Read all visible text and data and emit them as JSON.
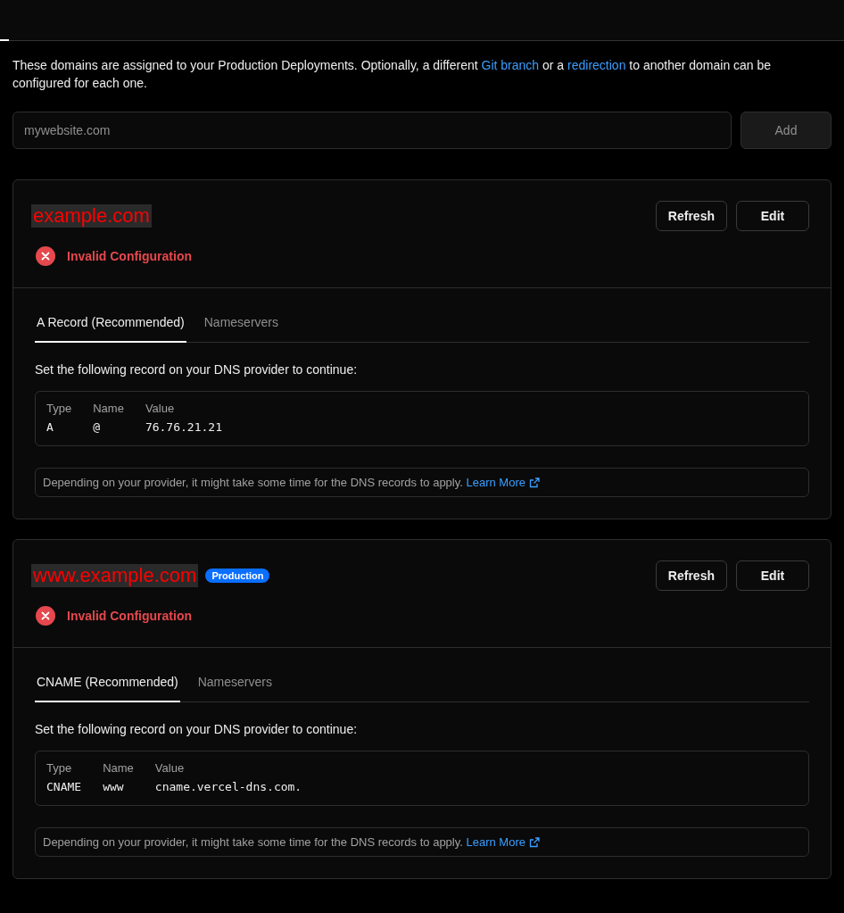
{
  "intro": {
    "text": "These domains are assigned to your Production Deployments. Optionally, a different ",
    "link1": "Git branch",
    "middle": " or a ",
    "link2": "redirection",
    "end": " to another domain can be configured for each one."
  },
  "add_form": {
    "placeholder": "mywebsite.com",
    "button": "Add"
  },
  "domains": [
    {
      "name": "example.com",
      "buttons": [
        "Refresh",
        "Edit"
      ],
      "status": "Invalid Configuration",
      "tabs": [
        {
          "label": "A Record (Recommended)",
          "selected": true
        },
        {
          "label": "Nameservers",
          "selected": false
        }
      ],
      "instruction": "Set the following record on your DNS provider to continue:",
      "record": {
        "columns": [
          "Type",
          "Name",
          "Value"
        ],
        "values": [
          "A",
          "@",
          "76.76.21.21"
        ]
      },
      "note": "Depending on your provider, it might take some time for the DNS records to apply. ",
      "note_link": "Learn More"
    },
    {
      "name": "www.example.com",
      "badge": "Production",
      "buttons": [
        "Refresh",
        "Edit"
      ],
      "status": "Invalid Configuration",
      "tabs": [
        {
          "label": "CNAME (Recommended)",
          "selected": true
        },
        {
          "label": "Nameservers",
          "selected": false
        }
      ],
      "instruction": "Set the following record on your DNS provider to continue:",
      "record": {
        "columns": [
          "Type",
          "Name",
          "Value"
        ],
        "values": [
          "CNAME",
          "www",
          "cname.vercel-dns.com."
        ]
      },
      "note": "Depending on your provider, it might take some time for the DNS records to apply. ",
      "note_link": "Learn More"
    }
  ]
}
